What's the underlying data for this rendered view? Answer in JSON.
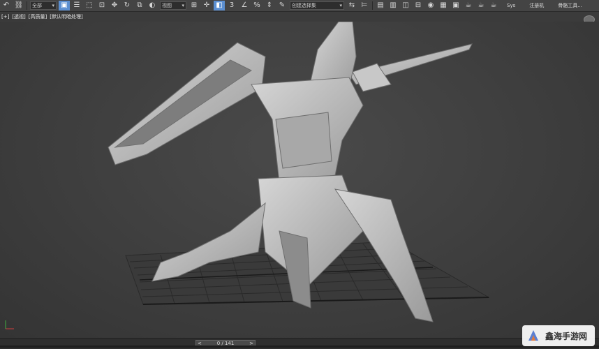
{
  "toolbar": {
    "selection_filter": "全部",
    "view_dropdown": "视图",
    "spinner_label": "3",
    "named_selection_set": "创建选择集",
    "text_buttons": [
      "Sys",
      "注册机",
      "骨骼工具..."
    ]
  },
  "viewport": {
    "labels": [
      "[+]",
      "[透视]",
      "[高质量]",
      "[默认明暗处理]"
    ]
  },
  "timeline": {
    "frame_readout": "0 / 141"
  },
  "watermark": {
    "text": "鑫海手游网"
  },
  "colors": {
    "accent": "#5b8fd1",
    "grid": "#2a2a2a",
    "model": "#b9b9b9"
  }
}
